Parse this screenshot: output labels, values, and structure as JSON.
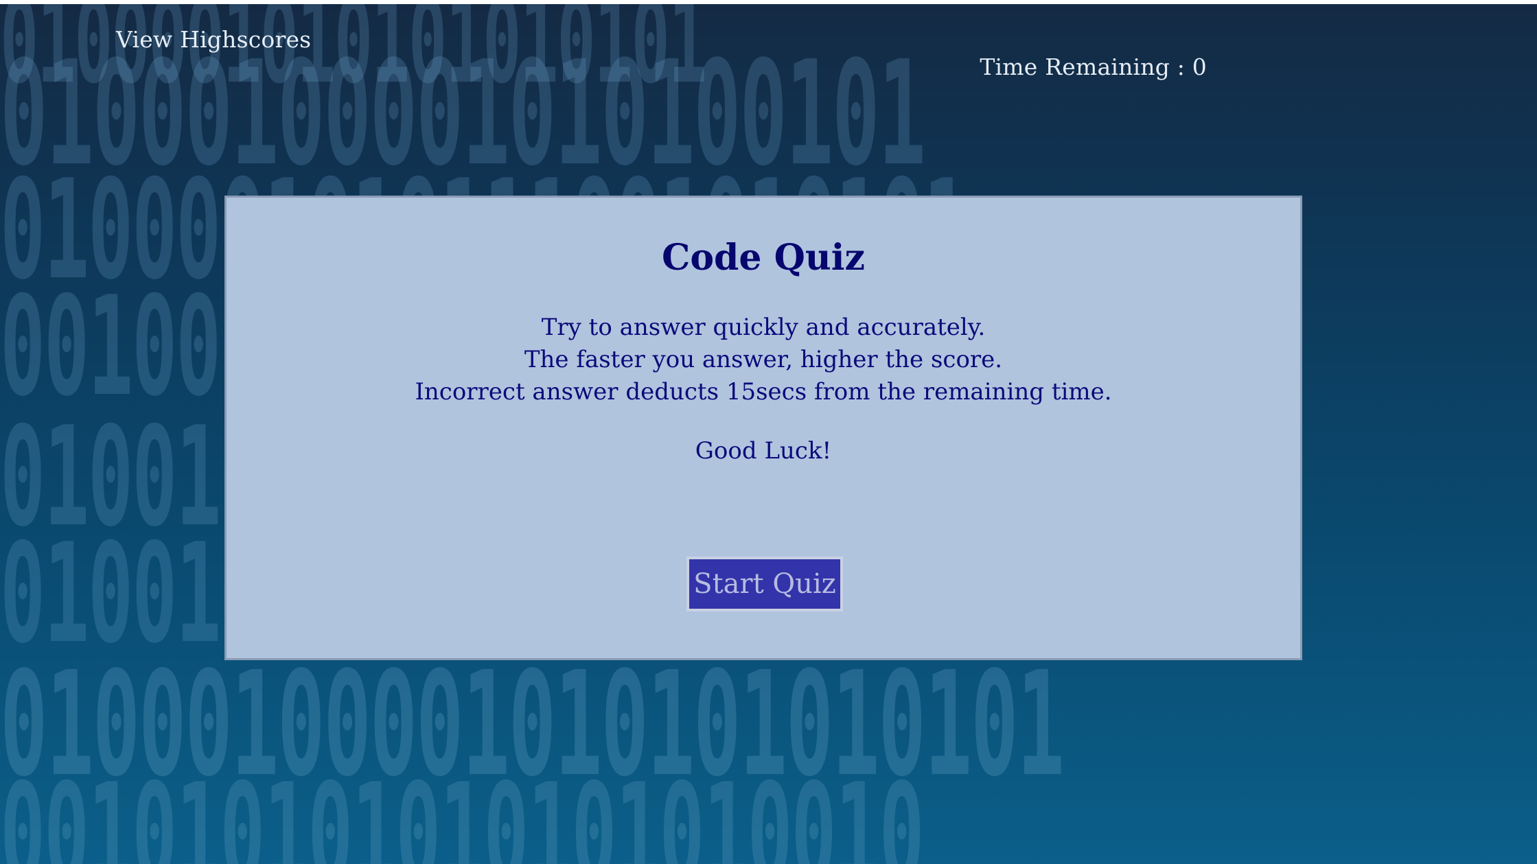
{
  "header": {
    "highscores_link": "View Highscores",
    "timer_label": "Time Remaining :",
    "timer_value": "0"
  },
  "background": {
    "rows": [
      "0100001010101010101",
      "01000100001010100101",
      "0100001010111001010101",
      "0010010101000110101011",
      "0100101010001011001010",
      "0100101010010100101101",
      "01000100001010101010101",
      "001010101010101010010"
    ]
  },
  "quiz": {
    "title": "Code Quiz",
    "instructions": [
      "Try to answer quickly and accurately.",
      "The faster you answer, higher the score.",
      "Incorrect answer deducts 15secs from the remaining time."
    ],
    "closing": "Good Luck!",
    "start_button": "Start Quiz"
  },
  "colors": {
    "card_background": "#b0c4de",
    "title_text": "#06066e",
    "button_background": "#3333aa",
    "header_text": "#e6edf5"
  }
}
